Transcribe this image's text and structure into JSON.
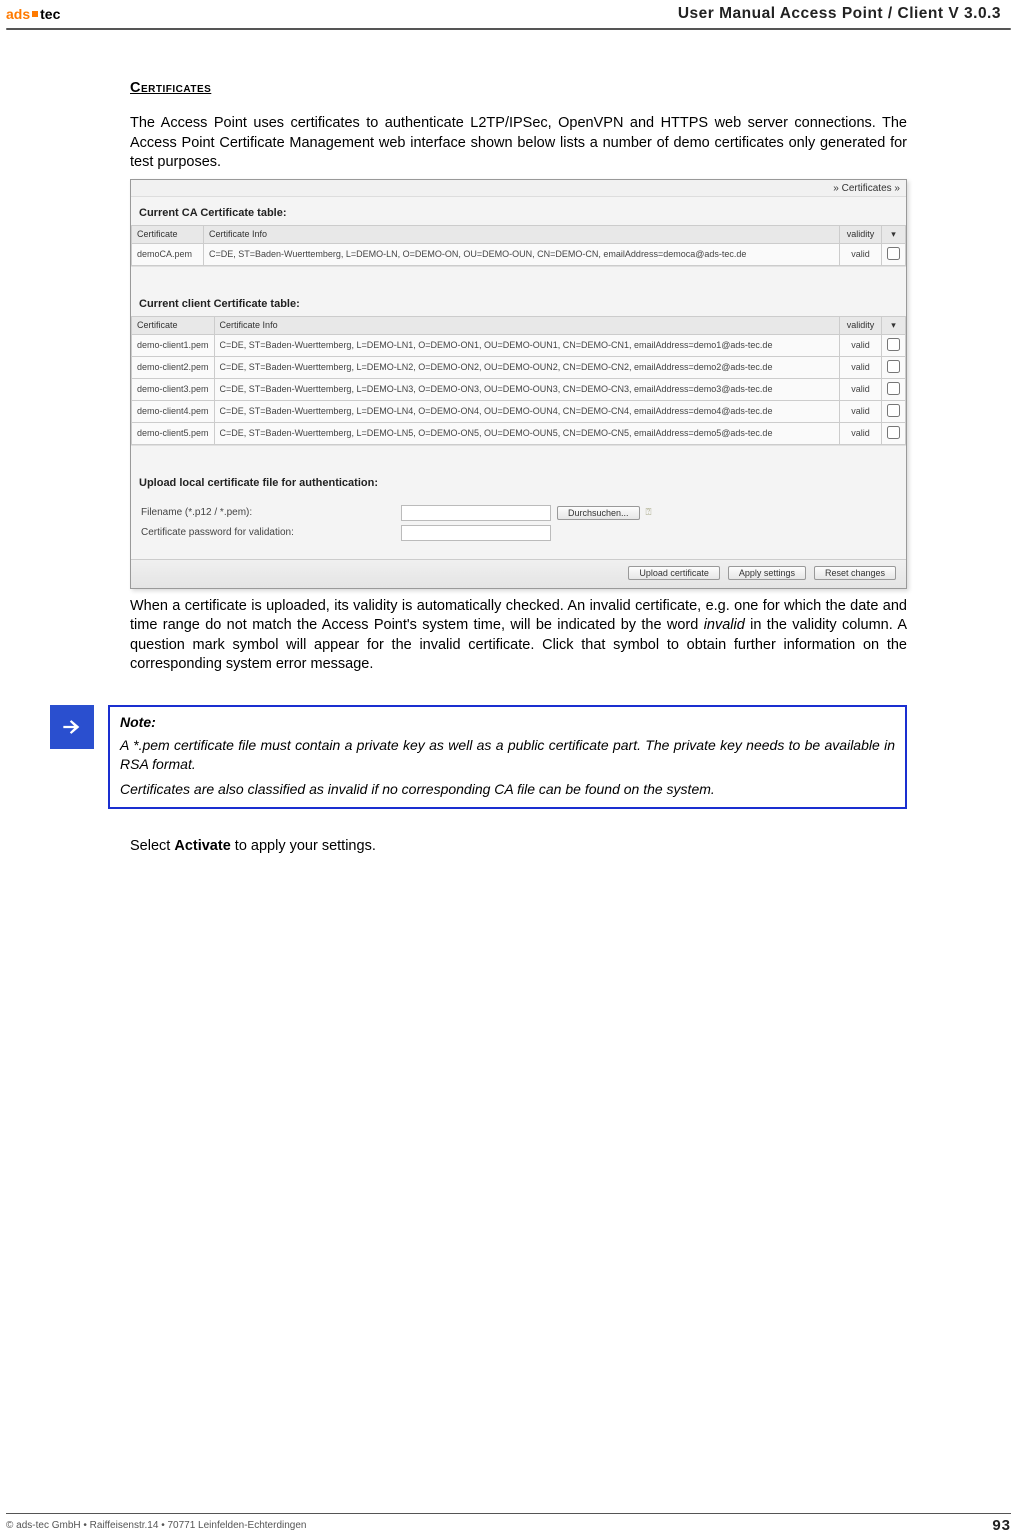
{
  "header": {
    "logo_a": "ads",
    "logo_b": "tec",
    "title": "User Manual Access  Point / Client V 3.0.3"
  },
  "section": {
    "heading": "Certificates",
    "para1": "The Access Point uses certificates to authenticate L2TP/IPSec, OpenVPN and HTTPS web server connections. The Access Point Certificate Management web interface shown below lists a number of demo certificates only generated for test purposes.",
    "para2a": "When a certificate is uploaded, its validity is automatically checked. An invalid certificate, e.g. one for which the date and time range do not match the Access Point's system time, will be indicated by the word ",
    "para2_invalid": "invalid",
    "para2b": " in the validity column. A question mark symbol will appear for the invalid certificate. Click that symbol to obtain further information on the corresponding system error message.",
    "para3a": "Select ",
    "para3_bold": "Activate",
    "para3b": " to apply your settings."
  },
  "screenshot": {
    "breadcrumb": "» Certificates »",
    "ca_heading": "Current CA Certificate table:",
    "client_heading": "Current client Certificate table:",
    "cols": {
      "cert": "Certificate",
      "info": "Certificate Info",
      "validity": "validity"
    },
    "ca_rows": [
      {
        "cert": "demoCA.pem",
        "info": "C=DE, ST=Baden-Wuerttemberg, L=DEMO-LN, O=DEMO-ON, OU=DEMO-OUN, CN=DEMO-CN, emailAddress=democa@ads-tec.de",
        "validity": "valid"
      }
    ],
    "client_rows": [
      {
        "cert": "demo-client1.pem",
        "info": "C=DE, ST=Baden-Wuerttemberg, L=DEMO-LN1, O=DEMO-ON1, OU=DEMO-OUN1, CN=DEMO-CN1, emailAddress=demo1@ads-tec.de",
        "validity": "valid"
      },
      {
        "cert": "demo-client2.pem",
        "info": "C=DE, ST=Baden-Wuerttemberg, L=DEMO-LN2, O=DEMO-ON2, OU=DEMO-OUN2, CN=DEMO-CN2, emailAddress=demo2@ads-tec.de",
        "validity": "valid"
      },
      {
        "cert": "demo-client3.pem",
        "info": "C=DE, ST=Baden-Wuerttemberg, L=DEMO-LN3, O=DEMO-ON3, OU=DEMO-OUN3, CN=DEMO-CN3, emailAddress=demo3@ads-tec.de",
        "validity": "valid"
      },
      {
        "cert": "demo-client4.pem",
        "info": "C=DE, ST=Baden-Wuerttemberg, L=DEMO-LN4, O=DEMO-ON4, OU=DEMO-OUN4, CN=DEMO-CN4, emailAddress=demo4@ads-tec.de",
        "validity": "valid"
      },
      {
        "cert": "demo-client5.pem",
        "info": "C=DE, ST=Baden-Wuerttemberg, L=DEMO-LN5, O=DEMO-ON5, OU=DEMO-OUN5, CN=DEMO-CN5, emailAddress=demo5@ads-tec.de",
        "validity": "valid"
      }
    ],
    "upload_heading": "Upload local certificate file for authentication:",
    "upload_filename_label": "Filename (*.p12 / *.pem):",
    "upload_password_label": "Certificate password for validation:",
    "browse_btn": "Durchsuchen...",
    "btn_upload": "Upload certificate",
    "btn_apply": "Apply settings",
    "btn_reset": "Reset changes"
  },
  "note": {
    "title": "Note:",
    "line1": "A *.pem certificate file must contain a private key as well as a public certificate part. The private key needs to be available in RSA format.",
    "line2": "Certificates are also classified as invalid if no corresponding CA file can be found on the system."
  },
  "footer": {
    "left": "© ads-tec GmbH • Raiffeisenstr.14 • 70771 Leinfelden-Echterdingen",
    "page": "93"
  }
}
